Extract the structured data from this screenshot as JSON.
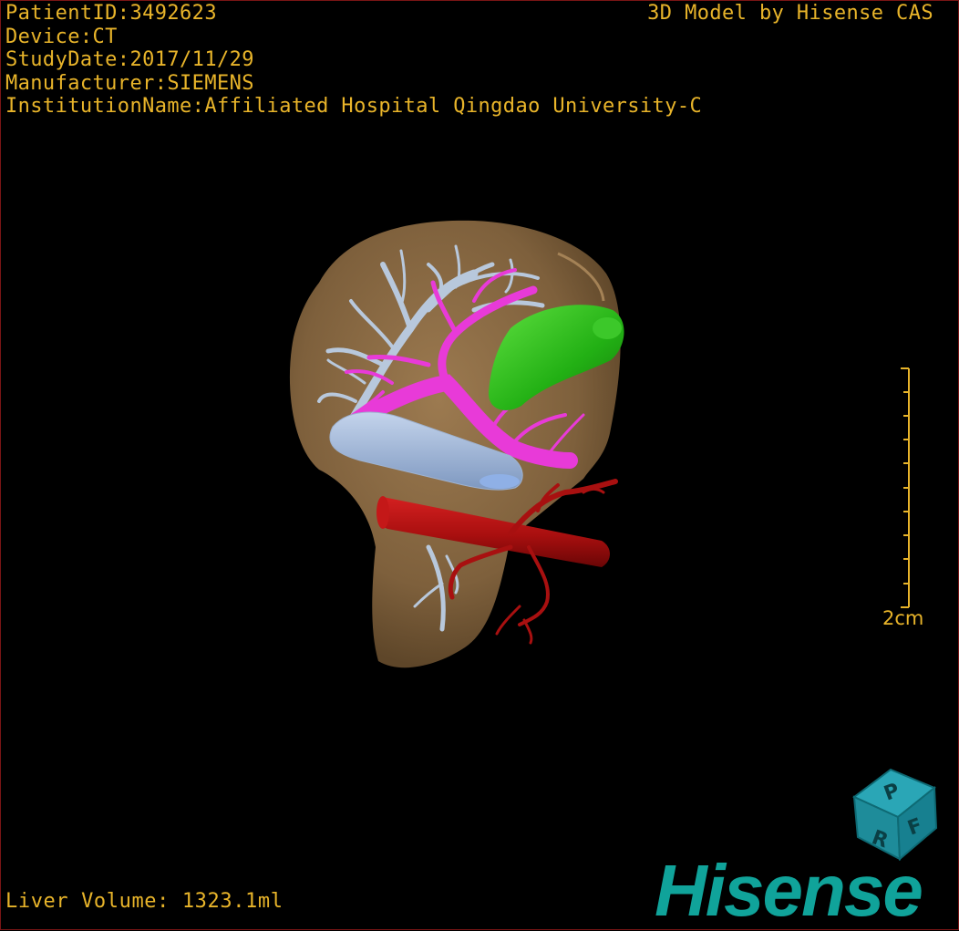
{
  "patient_info": {
    "patient_id": "PatientID:3492623",
    "device": "Device:CT",
    "study_date": "StudyDate:2017/11/29",
    "manufacturer": "Manufacturer:SIEMENS",
    "institution": "InstitutionName:Affiliated Hospital Qingdao University-C"
  },
  "credit": "3D Model by Hisense CAS",
  "liver_volume": "Liver Volume: 1323.1ml",
  "scale_bar": {
    "label": "2cm"
  },
  "orientation_cube": {
    "faces": [
      "P",
      "R",
      "F"
    ],
    "icon": "orientation-cube-icon"
  },
  "logo": "Hisense",
  "colors": {
    "text": "#e8b42a",
    "liver": "#8a6a44",
    "portal_vein": "#e83ad8",
    "hepatic_vein": "#b8c8dc",
    "gallbladder": "#2fc21c",
    "artery": "#b01010",
    "logo": "#10a39a"
  }
}
